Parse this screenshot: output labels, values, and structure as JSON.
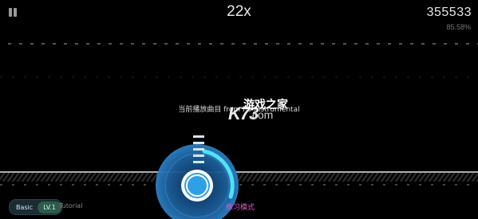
{
  "hud": {
    "combo": "22x",
    "score": "355533",
    "accuracy": "85.58%"
  },
  "hint_text": "当前播放曲目 from P0 Instrumental",
  "watermark": {
    "title": "游戏之家",
    "logo": "K73",
    "domain": ".com"
  },
  "mode_label": "练习模式",
  "level": {
    "difficulty": "Basic",
    "level": "LV.1"
  },
  "tutorial_label": "Tutorial",
  "progress_fraction": 0.3,
  "colors": {
    "note_blue": "#2f9fe8",
    "hold_cyan": "#4fe0f5",
    "mode_pink": "#e457c8"
  },
  "icons": {
    "pause": "pause-icon"
  }
}
